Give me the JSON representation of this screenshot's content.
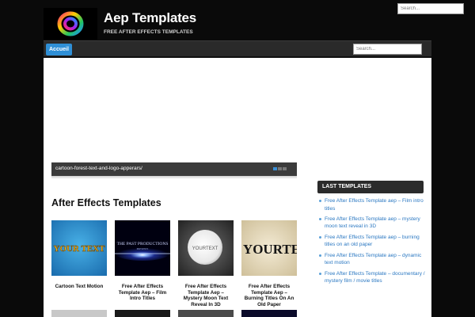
{
  "header": {
    "site_title": "Aep Templates",
    "tagline": "FREE AFTER EFFECTS TEMPLATES",
    "top_search_placeholder": "Search..."
  },
  "nav": {
    "home_label": "Accueil",
    "search_placeholder": "Search..."
  },
  "slider": {
    "caption": "cartoon-forest-text-and-logo-apperars/",
    "dots": 3,
    "active_dot": 1
  },
  "main": {
    "heading": "After Effects Templates",
    "posts": [
      {
        "title": "Cartoon Text Motion",
        "thumb_text": "YOUR TEXT"
      },
      {
        "title": "Free After Effects Template Aep – Film Intro Titles",
        "thumb_text": "THE PAST PRODUCTIONS",
        "thumb_subtext": "PRESENTS"
      },
      {
        "title": "Free After Effects Template Aep – Mystery Moon Text Reveal In 3D",
        "thumb_text": "YOURTEXT"
      },
      {
        "title": "Free After Effects Template Aep – Burning Titles On An Old Paper",
        "thumb_text": "YOURTE"
      }
    ]
  },
  "sidebar": {
    "title": "LAST TEMPLATES",
    "items": [
      "Free After Effects Template aep – Film intro titles",
      "Free After Effects Template aep – mystery moon text reveal in 3D",
      "Free After Effects Template aep – burning titles on an old paper",
      "Free After Effects Template aep – dynamic text motion",
      "Free After Effects Template – documentary / mystery film / movie titles"
    ]
  },
  "colors": {
    "page_background": "#0a0a0a",
    "accent_blue": "#2f8fd6",
    "link_blue": "#2b78c2",
    "nav_background": "#2a2a2a"
  }
}
